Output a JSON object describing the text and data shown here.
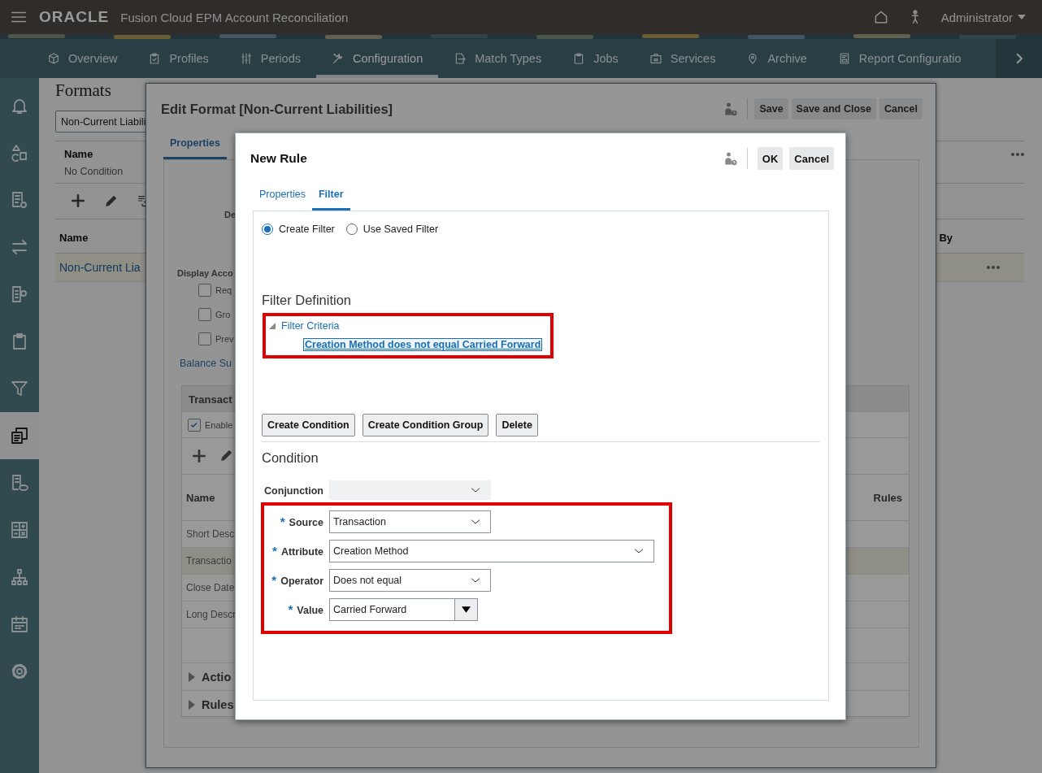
{
  "header": {
    "logo": "ORACLE",
    "app_title": "Fusion Cloud EPM Account Reconciliation",
    "user": "Administrator"
  },
  "nav_tabs": [
    {
      "label": "Overview",
      "selected": false
    },
    {
      "label": "Profiles",
      "selected": false
    },
    {
      "label": "Periods",
      "selected": false
    },
    {
      "label": "Configuration",
      "selected": true
    },
    {
      "label": "Match Types",
      "selected": false
    },
    {
      "label": "Jobs",
      "selected": false
    },
    {
      "label": "Services",
      "selected": false
    },
    {
      "label": "Archive",
      "selected": false
    },
    {
      "label": "Report Configuratio",
      "selected": false
    }
  ],
  "sidebar": {
    "items": [
      {
        "selected": false
      },
      {
        "selected": false
      },
      {
        "selected": false
      },
      {
        "selected": false
      },
      {
        "selected": false
      },
      {
        "selected": false
      },
      {
        "selected": false
      },
      {
        "selected": true
      },
      {
        "selected": false
      },
      {
        "selected": false
      },
      {
        "selected": false
      },
      {
        "selected": false
      },
      {
        "selected": false
      }
    ]
  },
  "page": {
    "title": "Formats",
    "search_value": "Non-Current Liabili",
    "filter_table": {
      "column": "Name",
      "row": "No Condition"
    },
    "formats_table": {
      "columns": [
        "Name",
        "By"
      ],
      "rows": [
        {
          "name": "Non-Current Lia",
          "selected": true
        }
      ]
    }
  },
  "edit_format": {
    "title": "Edit Format [Non-Current Liabilities]",
    "buttons": [
      "Save",
      "Save and Close",
      "Cancel"
    ],
    "tabs": [
      {
        "label": "Properties",
        "selected": true
      }
    ],
    "field_label": "De",
    "display_label": "Display Acco",
    "checkboxes": [
      {
        "label": "Req",
        "checked": false
      },
      {
        "label": "Gro",
        "checked": false
      },
      {
        "label": "Prev",
        "checked": false
      }
    ],
    "link": "Balance Su",
    "section": {
      "title": "Transact",
      "enable": {
        "label": "Enable",
        "checked": true
      },
      "columns": [
        "Name",
        "Rules"
      ],
      "rows": [
        {
          "name": "Short Desc",
          "selected": false
        },
        {
          "name": "Transactio",
          "selected": true
        },
        {
          "name": "Close Date",
          "selected": false
        },
        {
          "name": "Long Descr",
          "selected": false
        }
      ],
      "collapsibles": [
        {
          "label": "Actio",
          "expanded": false
        },
        {
          "label": "Rules",
          "expanded": false
        }
      ]
    }
  },
  "new_rule": {
    "title": "New Rule",
    "buttons": [
      "OK",
      "Cancel"
    ],
    "tabs": [
      {
        "label": "Properties",
        "selected": false
      },
      {
        "label": "Filter",
        "selected": true
      }
    ],
    "filter_mode": [
      {
        "label": "Create Filter",
        "selected": true
      },
      {
        "label": "Use Saved Filter",
        "selected": false
      }
    ],
    "definition_title": "Filter Definition",
    "tree_highlighted": true,
    "tree": [
      {
        "label": "Filter Criteria",
        "expanded": true,
        "children": [
          {
            "label": "Creation Method does not equal Carried Forward",
            "selected": true
          }
        ]
      }
    ],
    "actions": [
      "Create Condition",
      "Create Condition Group",
      "Delete"
    ],
    "condition_title": "Condition",
    "conjunction": {
      "label": "Conjunction",
      "disabled": true
    },
    "fields_highlighted": true,
    "fields": [
      {
        "kind": "select",
        "required_mark": "*",
        "label": "Source",
        "value": "Transaction"
      },
      {
        "kind": "select",
        "required_mark": "*",
        "label": "Attribute",
        "value": "Creation Method"
      },
      {
        "kind": "select",
        "required_mark": "*",
        "label": "Operator",
        "value": "Does not equal"
      },
      {
        "kind": "combo",
        "required_mark": "*",
        "label": "Value",
        "value": "Carried Forward"
      }
    ]
  }
}
